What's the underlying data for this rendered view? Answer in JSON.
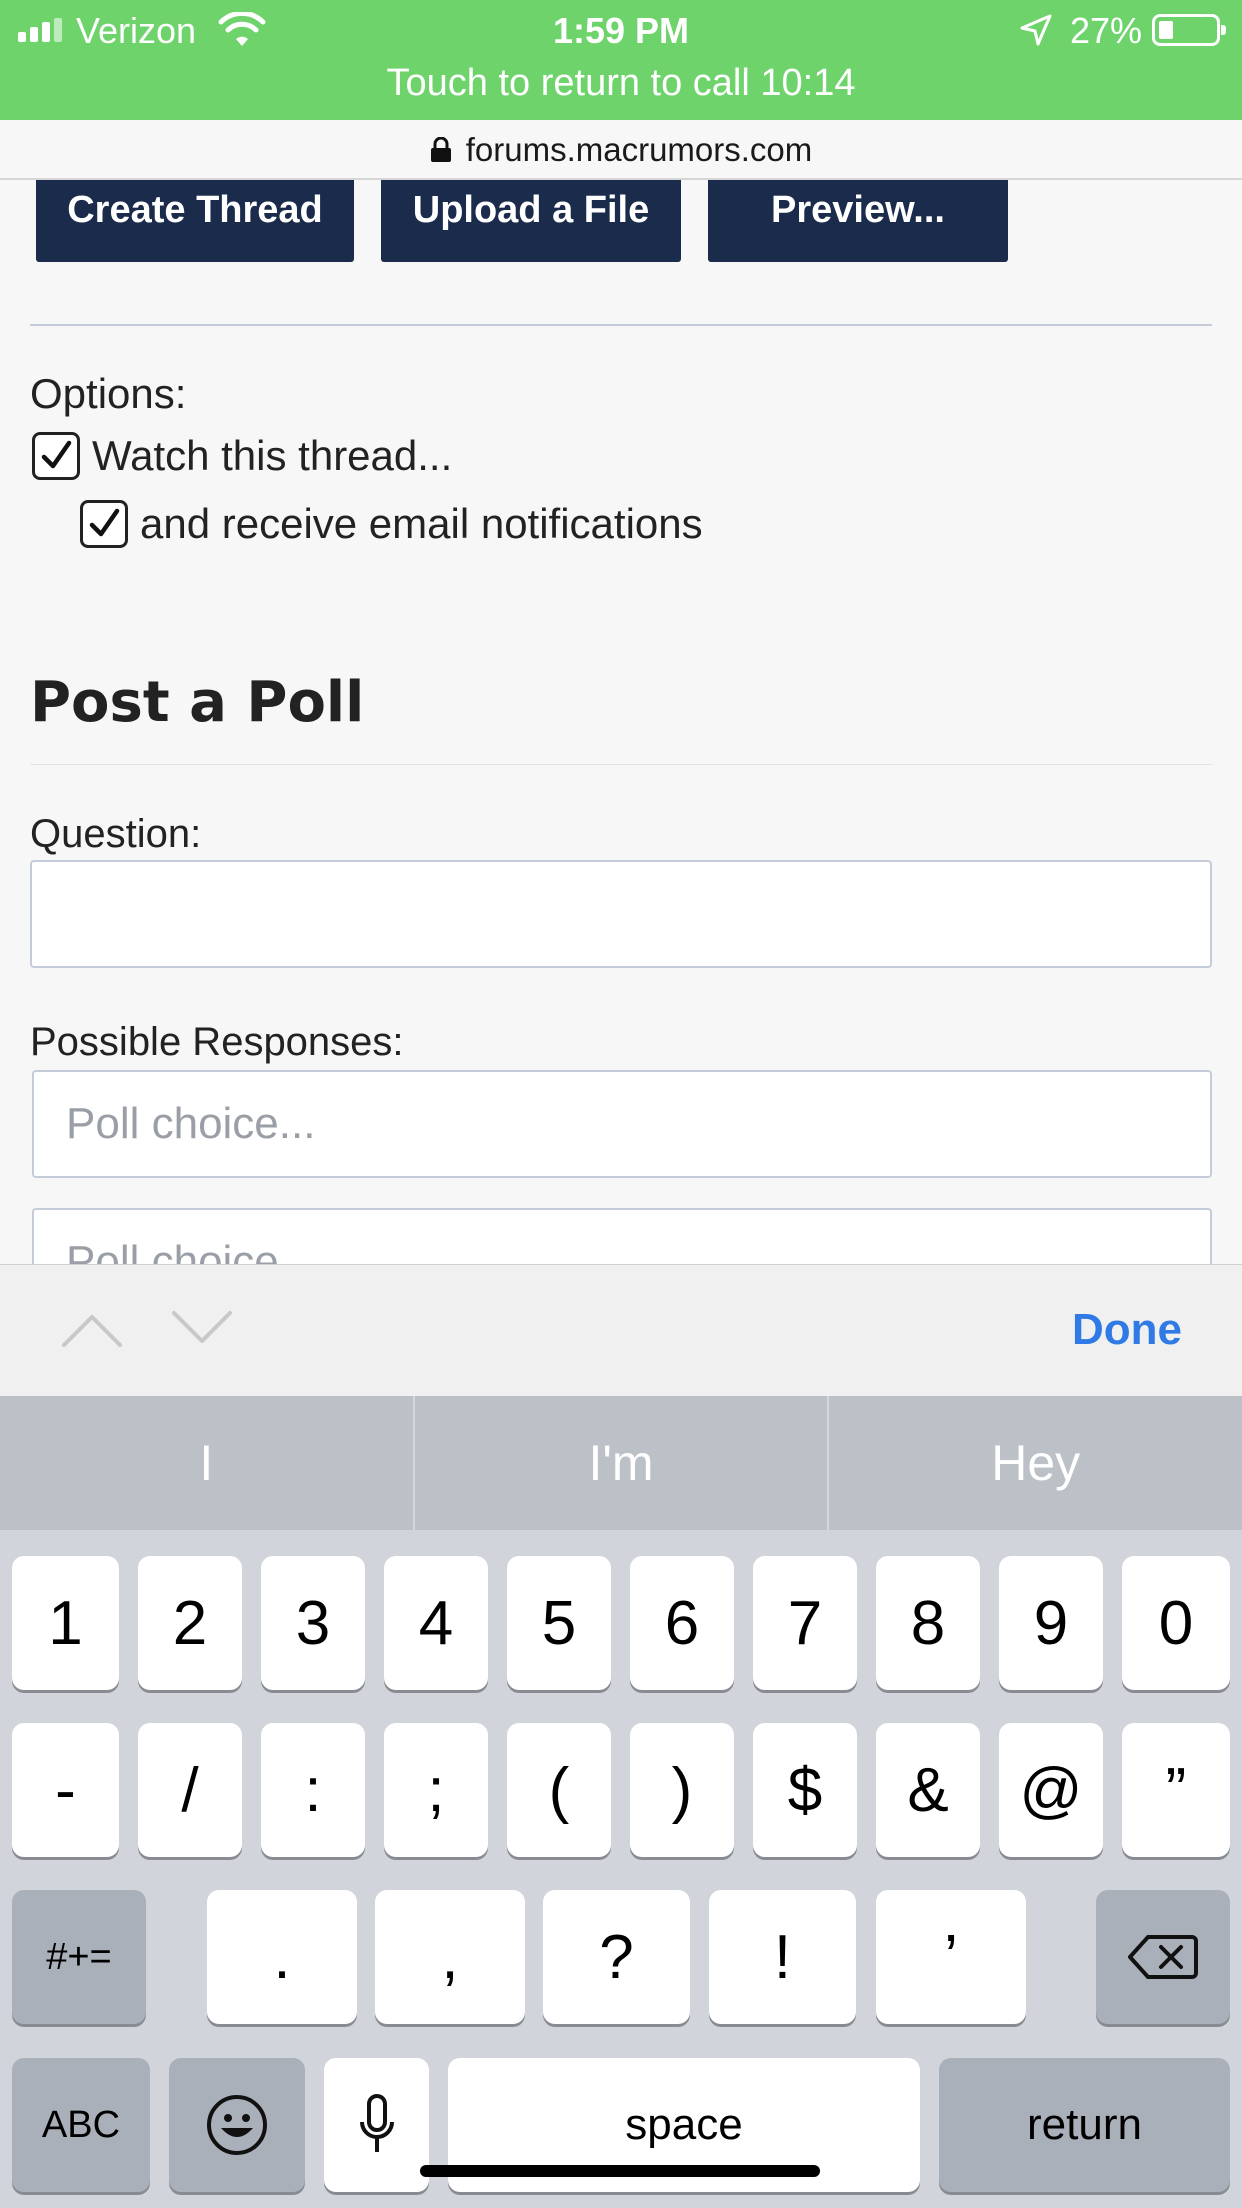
{
  "status_bar": {
    "carrier": "Verizon",
    "time": "1:59 PM",
    "battery": "27%",
    "battery_level": 0.27,
    "call_banner": "Touch to return to call 10:14"
  },
  "browser": {
    "url": "forums.macrumors.com"
  },
  "page": {
    "buttons": {
      "create": "Create Thread",
      "upload": "Upload a File",
      "preview": "Preview..."
    },
    "options_label": "Options:",
    "watch_label": "Watch this thread...",
    "email_label": "and receive email notifications",
    "poll_heading": "Post a Poll",
    "question_label": "Question:",
    "question_value": "",
    "responses_label": "Possible Responses:",
    "choice_placeholder": "Poll choice..."
  },
  "accessory": {
    "done": "Done"
  },
  "predictive": [
    "I",
    "I'm",
    "Hey"
  ],
  "keyboard": {
    "row1": [
      "1",
      "2",
      "3",
      "4",
      "5",
      "6",
      "7",
      "8",
      "9",
      "0"
    ],
    "row2": [
      "-",
      "/",
      ":",
      ";",
      "(",
      ")",
      "$",
      "&",
      "@",
      "”"
    ],
    "row3": [
      ".",
      ",",
      "?",
      "!",
      "’"
    ],
    "symbols": "#+=",
    "abc": "ABC",
    "space": "space",
    "return": "return"
  },
  "icons": {
    "lock": "lock-icon",
    "wifi": "wifi-icon",
    "location": "location-arrow-icon",
    "emoji": "emoji-icon",
    "mic": "microphone-icon",
    "delete": "delete-icon",
    "up": "chevron-up-icon",
    "down": "chevron-down-icon"
  },
  "colors": {
    "status_green": "#6fd36c",
    "button_navy": "#1b2b4b",
    "done_blue": "#2f7ae5"
  }
}
